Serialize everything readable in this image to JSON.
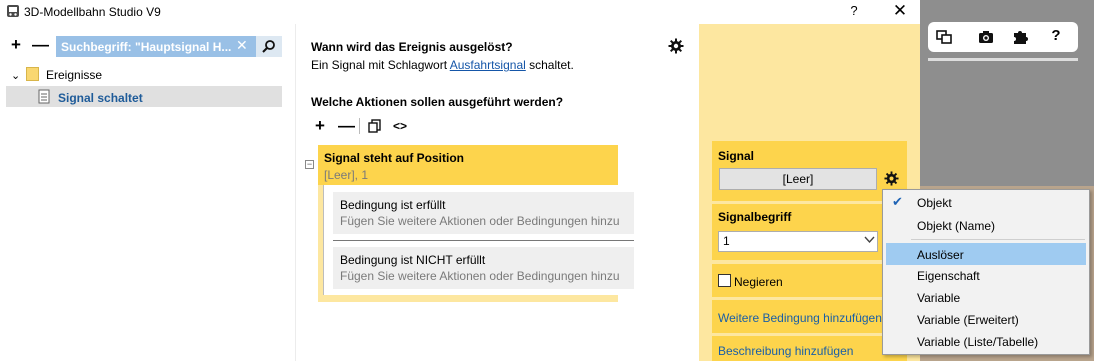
{
  "window": {
    "title": "3D-Modellbahn Studio V9",
    "help_label": "?",
    "close_label": "✕"
  },
  "tree": {
    "add_label": "+",
    "remove_label": "—",
    "search_text": "Suchbegriff: \"Hauptsignal H...",
    "search_clear": "✕",
    "folder_chevron": "⌄",
    "folder_label": "Ereignisse",
    "item_label": "Signal schaltet"
  },
  "trigger": {
    "heading": "Wann wird das Ereignis ausgelöst?",
    "text_before": "Ein Signal mit Schlagwort ",
    "link": "Ausfahrtsignal",
    "text_after": " schaltet."
  },
  "actions": {
    "heading": "Welche Aktionen sollen ausgeführt werden?",
    "add_label": "+",
    "remove_label": "—",
    "code_label": "<>",
    "collapse_label": "−",
    "block_title": "Signal steht auf Position",
    "block_subtitle": "[Leer], 1",
    "conditions": [
      {
        "title": "Bedingung ist erfüllt",
        "hint": "Fügen Sie weitere Aktionen oder Bedingungen hinzu"
      },
      {
        "title": "Bedingung ist NICHT erfüllt",
        "hint": "Fügen Sie weitere Aktionen oder Bedingungen hinzu"
      }
    ]
  },
  "properties": {
    "signal_label": "Signal",
    "signal_value": "[Leer]",
    "signalbegriff_label": "Signalbegriff",
    "signalbegriff_value": "1",
    "negieren_label": "Negieren",
    "negieren_checked": false,
    "weitere_label": "Weitere Bedingung hinzufügen",
    "beschreibung_label": "Beschreibung hinzufügen"
  },
  "context_menu": {
    "check_mark": "✔",
    "items": [
      "Objekt",
      "Objekt (Name)",
      "Auslöser",
      "Eigenschaft",
      "Variable",
      "Variable (Erweitert)",
      "Variable (Liste/Tabelle)"
    ],
    "checked_item": "Objekt",
    "highlighted_item": "Auslöser"
  },
  "view_toolbar": {
    "icons": [
      "windows-icon",
      "camera-icon",
      "puzzle-icon",
      "help-icon"
    ],
    "help_label": "?"
  },
  "colors": {
    "accent_yellow": "#fdd44c",
    "panel_yellow": "#fde7a0",
    "selection_blue": "#99c0e6",
    "menu_highlight": "#9fcbf1",
    "link_blue": "#1a5fa6"
  }
}
